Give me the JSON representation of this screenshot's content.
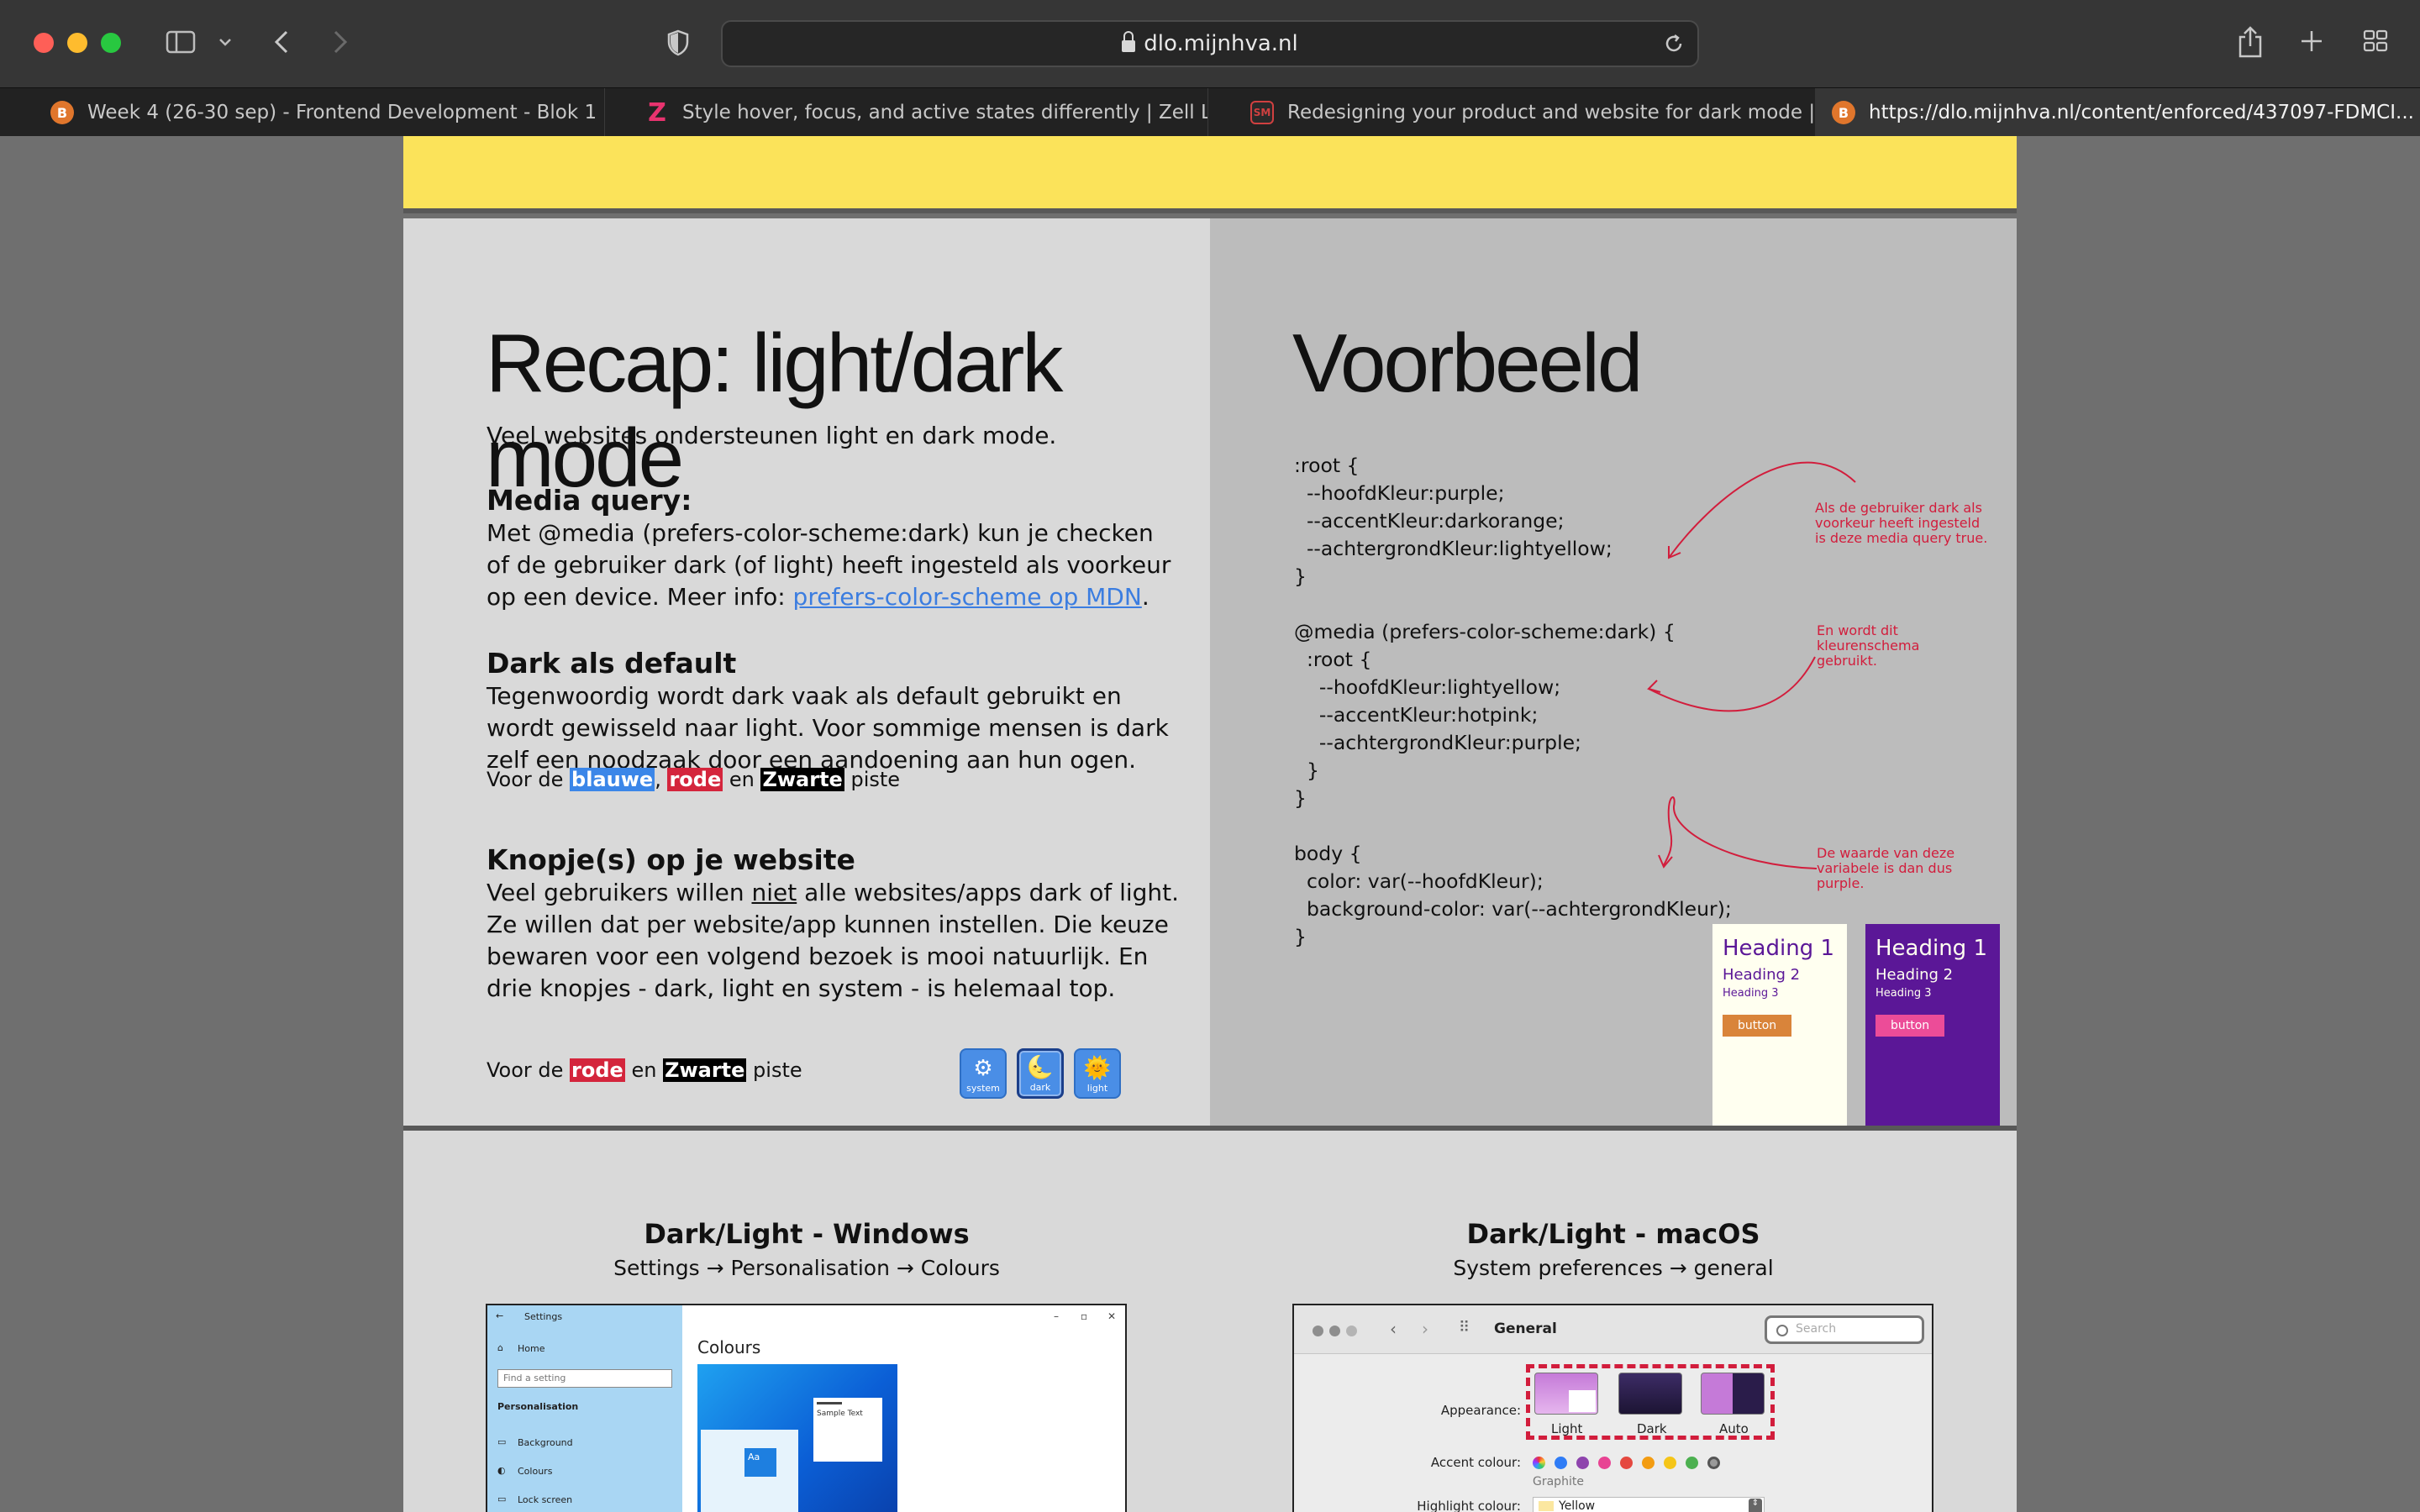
{
  "browser": {
    "url": "dlo.mijnhva.nl",
    "tabs": [
      {
        "title": "Week 4 (26-30 sep) - Frontend Development - Blok 1",
        "favicon": "brightspace-icon"
      },
      {
        "title": "Style hover, focus, and active states differently | Zell Li...",
        "favicon": "zell-icon"
      },
      {
        "title": "Redesigning your product and website for dark mode  |...",
        "favicon": "smashing-icon"
      },
      {
        "title": "https://dlo.mijnhva.nl/content/enforced/437097-FDMCI...",
        "favicon": "brightspace-icon"
      }
    ]
  },
  "slide_left": {
    "title": "Recap: light/dark mode",
    "intro": "Veel websites ondersteunen light en dark mode.",
    "media_heading": "Media query:",
    "media_line1": "Met @media (prefers-color-scheme:dark) kun je checken",
    "media_line2": "of de gebruiker dark (of light) heeft ingesteld als voorkeur",
    "media_line3_pre": "op een device. Meer info: ",
    "media_link": "prefers-color-scheme op MDN",
    "media_line3_post": ".",
    "dark_heading": "Dark als default",
    "dark_line1": "Tegenwoordig wordt dark vaak als default gebruikt en",
    "dark_line2": "wordt gewisseld naar light. Voor sommige mensen is dark",
    "dark_line3": "zelf een noodzaak door een aandoening aan hun ogen.",
    "piste1_pre": "Voor de ",
    "piste1_blue": "blauwe",
    "piste1_comma": ", ",
    "piste1_red": "rode",
    "piste1_en": " en ",
    "piste1_black": "Zwarte",
    "piste1_post": " piste",
    "knop_heading": "Knopje(s) op je website",
    "knop_line1_pre": "Veel gebruikers willen ",
    "knop_line1_niet": "niet",
    "knop_line1_post": " alle websites/apps dark of light.",
    "knop_line2": "Ze willen dat per website/app kunnen instellen. Die keuze",
    "knop_line3": "bewaren voor een volgend bezoek is mooi natuurlijk. En",
    "knop_line4": "drie knopjes - dark, light en system - is helemaal top.",
    "piste2_pre": "Voor de ",
    "piste2_red": "rode",
    "piste2_en": " en ",
    "piste2_black": "Zwarte",
    "piste2_post": " piste",
    "mode_buttons": [
      {
        "label": "system",
        "glyph": "⚙"
      },
      {
        "label": "dark",
        "glyph": "🌜"
      },
      {
        "label": "light",
        "glyph": "🌞"
      }
    ]
  },
  "slide_right": {
    "title": "Voorbeeld",
    "code": ":root {\n  --hoofdKleur:purple;\n  --accentKleur:darkorange;\n  --achtergrondKleur:lightyellow;\n}\n\n@media (prefers-color-scheme:dark) {\n  :root {\n    --hoofdKleur:lightyellow;\n    --accentKleur:hotpink;\n    --achtergrondKleur:purple;\n  }\n}\n\nbody {\n  color: var(--hoofdKleur);\n  background-color: var(--achtergrondKleur);\n}",
    "note1": "Als de gebruiker dark als voorkeur heeft ingesteld is deze media query true.",
    "note2": "En wordt dit kleurenschema gebruikt.",
    "note3": "De waarde van deze variabele is dan dus purple.",
    "demo_light": {
      "h1": "Heading 1",
      "h2": "Heading 2",
      "h3": "Heading 3",
      "button": "button"
    },
    "demo_dark": {
      "h1": "Heading 1",
      "h2": "Heading 2",
      "h3": "Heading 3",
      "button": "button"
    }
  },
  "slide_windows": {
    "title": "Dark/Light - Windows",
    "path": "Settings → Personalisation → Colours",
    "window_title": "Settings",
    "home": "Home",
    "search_placeholder": "Find a setting",
    "section": "Personalisation",
    "items": [
      "Background",
      "Colours",
      "Lock screen"
    ],
    "colours_title": "Colours",
    "sample_text": "Sample Text",
    "aa": "Aa"
  },
  "slide_macos": {
    "title": "Dark/Light - macOS",
    "path": "System preferences → general",
    "window_title": "General",
    "search_placeholder": "Search",
    "appearance_label": "Appearance:",
    "appearance_options": [
      "Light",
      "Dark",
      "Auto"
    ],
    "accent_label": "Accent colour:",
    "accent_selected": "Graphite",
    "highlight_label": "Highlight colour:",
    "highlight_value": "Yellow"
  },
  "colors": {
    "yellow_bar": "#fbe35a",
    "link": "#3b7de0",
    "annotation_red": "#d21d3c",
    "demo_light_bg": "#fffff0",
    "demo_dark_bg": "#5b1797",
    "demo_light_button": "#d9843a",
    "demo_dark_button": "#ec4c98"
  }
}
